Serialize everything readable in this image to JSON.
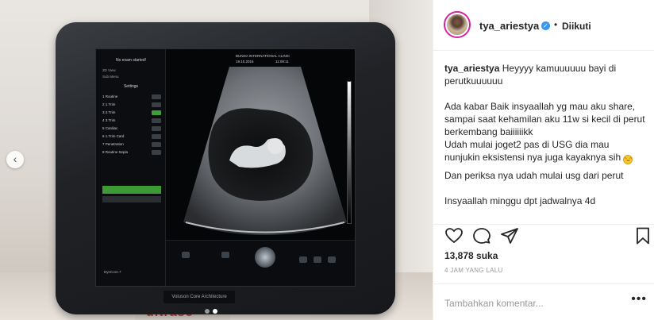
{
  "media": {
    "screen": {
      "sidebar_header": "No exam started!",
      "menu_items": [
        "3D View",
        "Sub Menu"
      ],
      "settings_title": "Settings",
      "rows": [
        {
          "num": "1",
          "label": "Routine"
        },
        {
          "num": "2",
          "label": "1.Trim"
        },
        {
          "num": "3",
          "label": "2.Trim"
        },
        {
          "num": "4",
          "label": "3.Trim"
        },
        {
          "num": "5",
          "label": "Cardiac"
        },
        {
          "num": "6",
          "label": "1.Trim Card"
        },
        {
          "num": "7",
          "label": "Penetration"
        },
        {
          "num": "8",
          "label": "Routine Sepia"
        }
      ],
      "clinic": "BUNDA INTERNATIONAL CLINIC",
      "date": "19.10.2016",
      "time": "11:09:11",
      "brand": "Voluson Core Architecture",
      "logo": "DynCore.7"
    },
    "sign_text": "ultrasc",
    "carousel": {
      "count": 2,
      "active": 2
    }
  },
  "post": {
    "username": "tya_ariestya",
    "follow_label": "Diikuti",
    "caption_username": "tya_ariestya",
    "caption_lines": [
      "Heyyyy kamuuuuuu bayi di perutkuuuuuu",
      "Ada kabar Baik insyaallah yg mau aku share, sampai saat kehamilan aku 11w si kecil di perut berkembang baiiiiiikk",
      "Udah mulai joget2 pas di USG dia mau nunjukin eksistensi nya juga kayaknya sih",
      "Dan periksa nya udah mulai usg dari perut",
      "Insyaallah minggu dpt jadwalnya 4d"
    ],
    "likes": "13,878 suka",
    "timestamp": "4 JAM YANG LALU",
    "comment_placeholder": "Tambahkan komentar...",
    "more_label": "•••"
  }
}
